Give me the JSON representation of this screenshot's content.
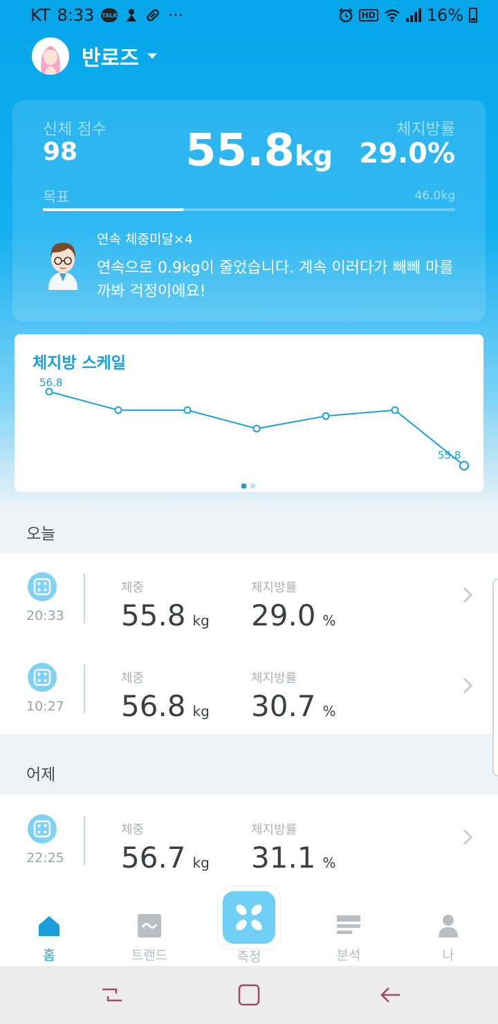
{
  "status_bar": {
    "carrier": "KT",
    "time": "8:33",
    "battery": "16%",
    "talk_badge": "TALK",
    "hd_badge": "HD",
    "more": "···",
    "icons": [
      "kakaotalk-icon",
      "app-notify-icon",
      "pill-icon",
      "alarm-icon",
      "hd-icon",
      "wifi-icon",
      "signal-icon",
      "battery-icon"
    ]
  },
  "profile": {
    "name": "반로즈"
  },
  "summary": {
    "score_label": "신체 점수",
    "score_value": "98",
    "weight_value": "55.8",
    "weight_unit": "kg",
    "fat_label": "체지방률",
    "fat_value": "29.0%",
    "goal_label": "목표",
    "goal_value": "46.0kg",
    "goal_progress_fraction": 0.34,
    "streak_title": "연속 체중미달×4",
    "message": "연속으로 0.9kg이 줄었습니다. 계속 이러다가 빼빼 마를까봐 걱정이에요!"
  },
  "chart_data": {
    "type": "line",
    "title": "체지방 스케일",
    "x": [
      1,
      2,
      3,
      4,
      5,
      6,
      7
    ],
    "values": [
      56.8,
      56.55,
      56.55,
      56.3,
      56.47,
      56.55,
      55.8
    ],
    "data_labels": {
      "first": "56.8",
      "last": "55.8"
    },
    "ylim": [
      55.8,
      56.8
    ],
    "grid": false,
    "page_indicator": {
      "count": 2,
      "active": 1
    },
    "color": "#1a9fd8"
  },
  "sections": [
    {
      "label": "오늘",
      "entries": [
        {
          "time": "20:33",
          "weight_label": "체중",
          "weight": "55.8",
          "weight_unit": "kg",
          "fat_label": "체지방률",
          "fat": "29.0",
          "fat_unit": "%"
        },
        {
          "time": "10:27",
          "weight_label": "체중",
          "weight": "56.8",
          "weight_unit": "kg",
          "fat_label": "체지방률",
          "fat": "30.7",
          "fat_unit": "%"
        }
      ]
    },
    {
      "label": "어제",
      "entries": [
        {
          "time": "22:25",
          "weight_label": "체중",
          "weight": "56.7",
          "weight_unit": "kg",
          "fat_label": "체지방률",
          "fat": "31.1",
          "fat_unit": "%"
        }
      ]
    }
  ],
  "bottom_nav": {
    "items": [
      {
        "label": "홈",
        "icon": "home-icon",
        "active": true
      },
      {
        "label": "트랜드",
        "icon": "trend-icon",
        "active": false
      },
      {
        "label": "측정",
        "icon": "scale-icon",
        "active": false
      },
      {
        "label": "분석",
        "icon": "analysis-icon",
        "active": false
      },
      {
        "label": "나",
        "icon": "person-icon",
        "active": false
      }
    ]
  },
  "colors": {
    "brand": "#05a6ea",
    "accent": "#1a9fd8",
    "badge": "#80d2f5",
    "value_text": "#3b3f44"
  }
}
